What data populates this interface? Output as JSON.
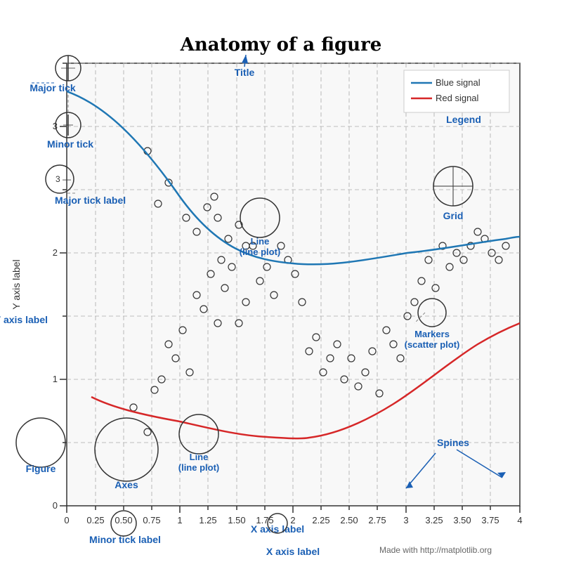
{
  "title": "Anatomy of a figure",
  "subtitle_title": "Title",
  "legend": {
    "label": "Legend",
    "blue_signal": "Blue signal",
    "red_signal": "Red signal"
  },
  "annotations": {
    "major_tick": "Major tick",
    "minor_tick": "Minor tick",
    "major_tick_label": "Major tick label",
    "minor_tick_label": "Minor tick label",
    "y_axis_label": "Y axis label",
    "x_axis_label": "X axis label",
    "line_plot": "Line\n(line plot)",
    "grid": "Grid",
    "markers": "Markers\n(scatter plot)",
    "spines": "Spines",
    "figure": "Figure",
    "axes": "Axes",
    "made_with": "Made with http://matplotlib.org"
  },
  "axis": {
    "x_ticks": [
      "0",
      "0.25",
      "0.50",
      "0.75",
      "1",
      "1.25",
      "1.50",
      "1.75",
      "2",
      "2.25",
      "2.50",
      "2.75",
      "3",
      "3.25",
      "3.50",
      "3.75",
      "4"
    ],
    "y_ticks": [
      "0",
      "1",
      "2",
      "3"
    ],
    "x_label": "X axis label",
    "y_label": "Y axis label"
  },
  "colors": {
    "blue": "#1f77b4",
    "red": "#d62728",
    "annotation": "#0055cc",
    "dashed_line": "#888888",
    "circle_stroke": "#333",
    "grid": "#aaaaaa"
  }
}
